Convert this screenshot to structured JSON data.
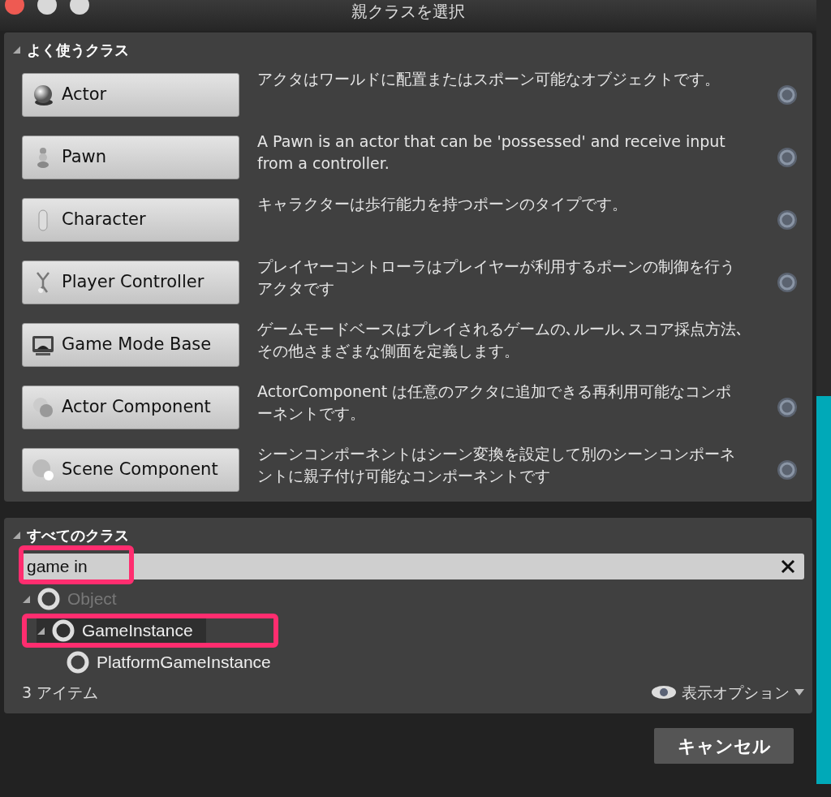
{
  "window": {
    "title": "親クラスを選択"
  },
  "common_classes": {
    "title": "よく使うクラス",
    "expanded": true,
    "items": [
      {
        "label": "Actor",
        "description": "アクタはワールドに配置またはスポーン可能なオブジェクトです。",
        "help": true
      },
      {
        "label": "Pawn",
        "description": "A Pawn is an actor that can be 'possessed' and receive input from a controller.",
        "help": true
      },
      {
        "label": "Character",
        "description": "キャラクターは歩行能力を持つポーンのタイプです。",
        "help": true
      },
      {
        "label": "Player Controller",
        "description": "プレイヤーコントローラはプレイヤーが利用するポーンの制御を行うアクタです",
        "help": true
      },
      {
        "label": "Game Mode Base",
        "description": "ゲームモードベースはプレイされるゲームの､ルール､スコア採点方法､その他さまざまな側面を定義します。",
        "help": false
      },
      {
        "label": "Actor Component",
        "description": "ActorComponent は任意のアクタに追加できる再利用可能なコンポーネントです。",
        "help": true
      },
      {
        "label": "Scene Component",
        "description": "シーンコンポーネントはシーン変換を設定して別のシーンコンポーネントに親子付け可能なコンポーネントです",
        "help": true
      }
    ]
  },
  "all_classes": {
    "title": "すべてのクラス",
    "expanded": true,
    "search": {
      "value": "game in",
      "highlighted": true
    },
    "tree": [
      {
        "label": "Object",
        "disabled": true,
        "expanded": true,
        "selected": false,
        "highlighted": false,
        "children": [
          {
            "label": "GameInstance",
            "disabled": false,
            "expanded": true,
            "selected": true,
            "highlighted": true,
            "children": [
              {
                "label": "PlatformGameInstance",
                "disabled": false,
                "selected": false,
                "highlighted": false
              }
            ]
          }
        ]
      }
    ],
    "count": "3 アイテム",
    "view_options": "表示オプション"
  },
  "buttons": [
    "キャンセル"
  ]
}
